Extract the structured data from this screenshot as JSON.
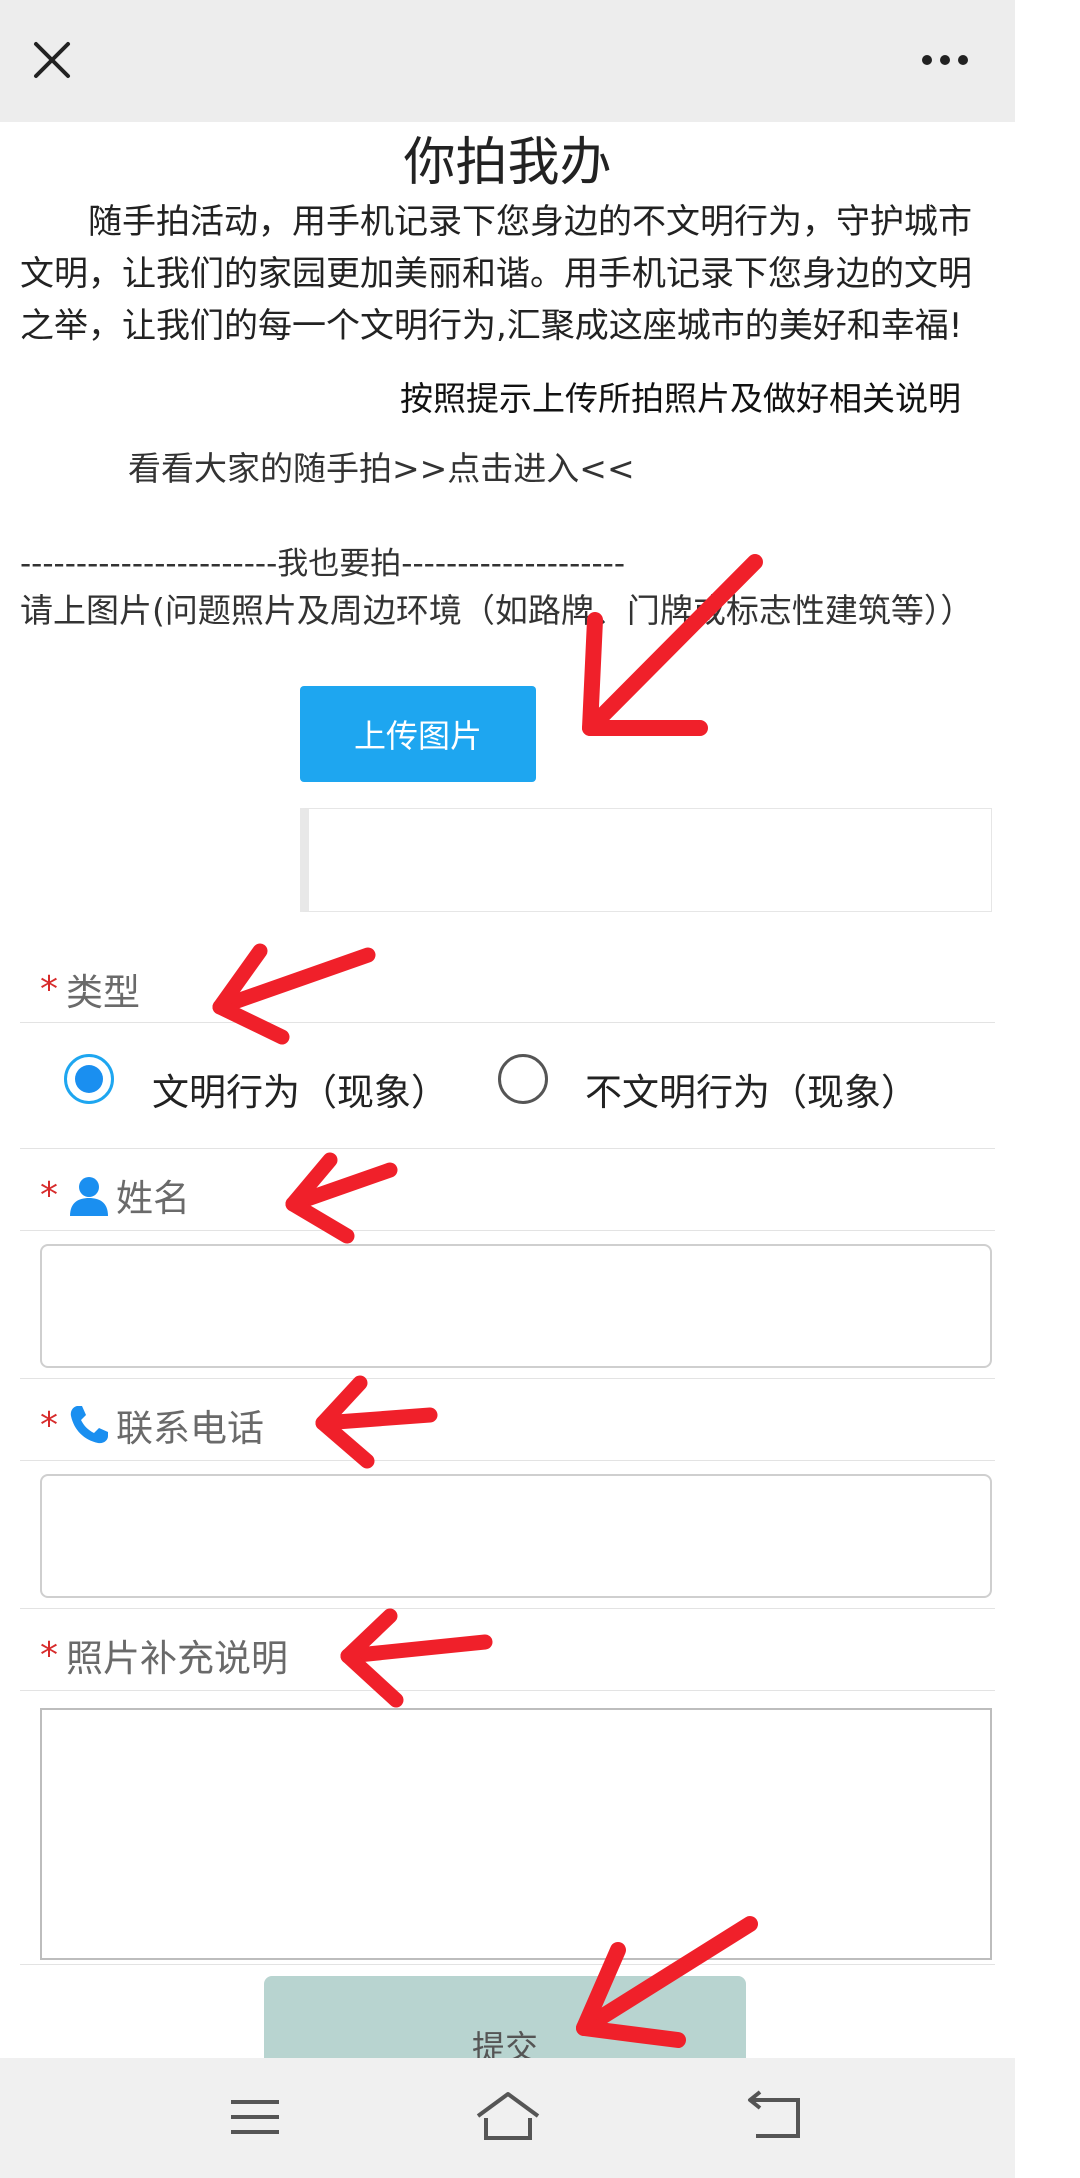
{
  "topbar": {
    "close_icon": "close-icon",
    "more_icon": "more-dots-icon"
  },
  "title": "你拍我办",
  "intro": "随手拍活动，用手机记录下您身边的不文明行为，守护城市文明，让我们的家园更加美丽和谐。用手机记录下您身边的文明之举，让我们的每一个文明行为,汇聚成这座城市的美好和幸福!",
  "hint": "按照提示上传所拍照片及做好相关说明",
  "view_link": "看看大家的随手拍>>点击进入<<",
  "section_sep": "-----------------------我也要拍--------------------",
  "upload": {
    "desc": "请上图片(问题照片及周边环境（如路牌、门牌或标志性建筑等））",
    "button_label": "上传图片"
  },
  "form": {
    "required_mark": "*",
    "type": {
      "label": "类型",
      "options": [
        "文明行为（现象）",
        "不文明行为（现象）"
      ],
      "selected": "文明行为（现象）"
    },
    "name": {
      "label": "姓名",
      "icon": "person-icon",
      "value": ""
    },
    "phone": {
      "label": "联系电话",
      "icon": "phone-icon",
      "value": ""
    },
    "remark": {
      "label": "照片补充说明",
      "value": ""
    },
    "submit_label": "提交"
  },
  "navbar": {
    "icons": [
      "menu-icon",
      "home-icon",
      "back-icon"
    ]
  },
  "colors": {
    "accent": "#1ea6f0",
    "required": "#d72b2b",
    "annotation_arrow": "#f0202a",
    "submit_bg": "#b8d4d0"
  }
}
